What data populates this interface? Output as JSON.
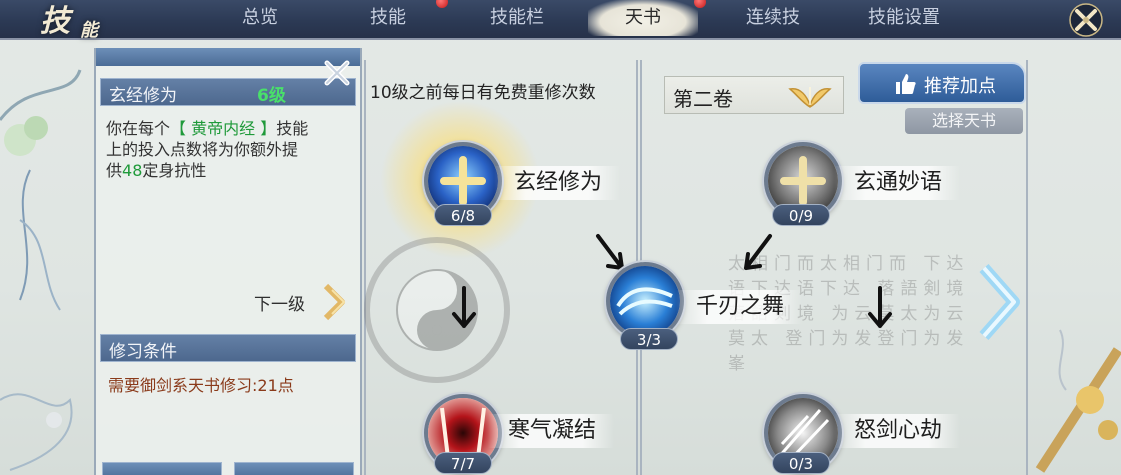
{
  "header": {
    "logo_big": "技",
    "logo_small": "能",
    "tabs": [
      {
        "label": "总览",
        "active": false
      },
      {
        "label": "技能",
        "active": false
      },
      {
        "label": "技能栏",
        "active": false
      },
      {
        "label": "天书",
        "active": true
      },
      {
        "label": "连续技",
        "active": false
      },
      {
        "label": "技能设置",
        "active": false
      }
    ]
  },
  "info_panel": {
    "skill_name": "玄经修为",
    "level": "6级",
    "desc_line1": "你在每个",
    "desc_highlight": "【 黄帝内经 】",
    "desc_line1_end": "技能",
    "desc_line2": "上的投入点数将为你额外提",
    "desc_line3_pre": "供",
    "desc_value": "48",
    "desc_line3_post": "定身抗性",
    "next_level": "下一级",
    "condition_title": "修习条件",
    "condition_text": "需要御剑系天书修习:21点"
  },
  "tree": {
    "free_respec_note": "10级之前每日有免费重修次数",
    "volume_label": "第二卷",
    "recommend_label": "推荐加点",
    "choose_book_label": "选择天书",
    "calligraphy": "太相门而太相门而 下达语下达语下达 落語剣境落語剣境 为云莫太为云莫太 登门为发登门为发 峯"
  },
  "skills": [
    {
      "name": "玄经修为",
      "count": "6/8",
      "icon": "blue-cross-icon"
    },
    {
      "name": "玄通妙语",
      "count": "0/9",
      "icon": "gray-cross-icon"
    },
    {
      "name": "千刃之舞",
      "count": "3/3",
      "icon": "blue-wave-icon"
    },
    {
      "name": "寒气凝结",
      "count": "7/7",
      "icon": "red-vortex-icon"
    },
    {
      "name": "怒剑心劫",
      "count": "0/3",
      "icon": "gray-blade-icon"
    }
  ],
  "colors": {
    "accent_green": "#49e06a",
    "highlight_green": "#1f9a3a",
    "condition_red": "#8a3a1a",
    "header_blue": "#4d688e"
  }
}
